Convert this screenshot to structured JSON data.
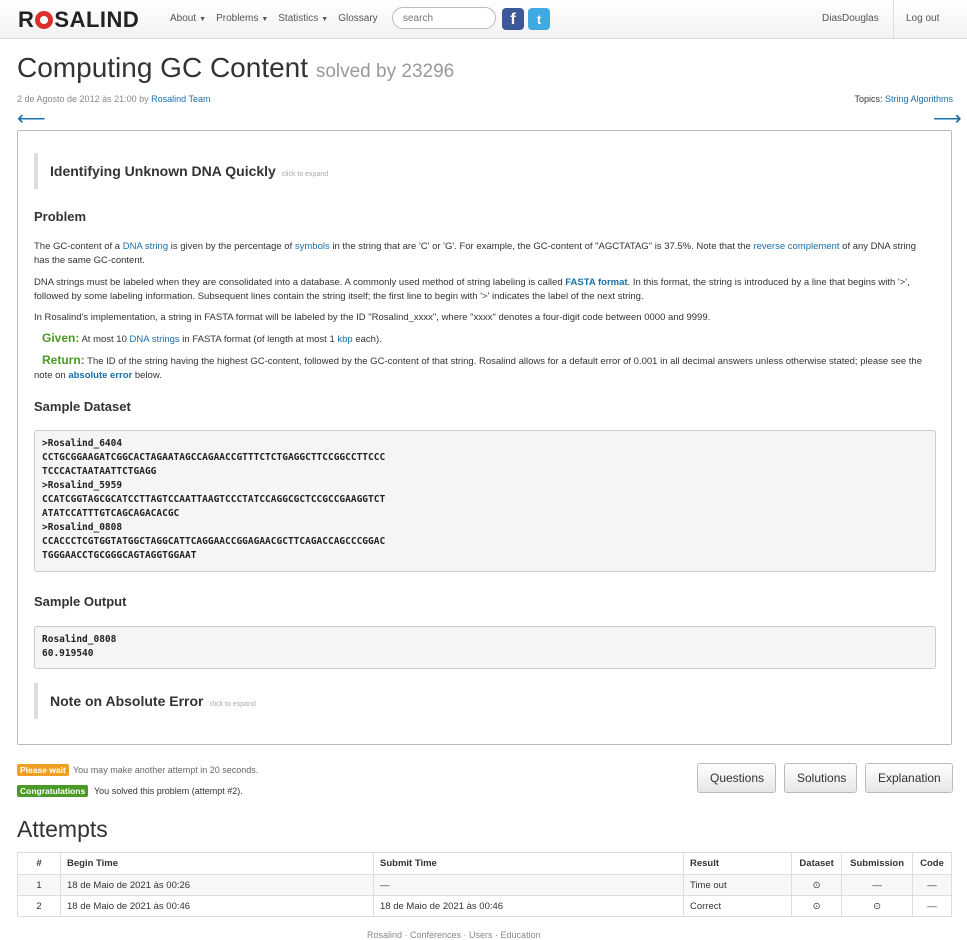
{
  "nav": {
    "logo": "ROSALIND",
    "menu": [
      {
        "label": "About",
        "caret": true
      },
      {
        "label": "Problems",
        "caret": true
      },
      {
        "label": "Statistics",
        "caret": true
      },
      {
        "label": "Glossary",
        "caret": false
      }
    ],
    "search_placeholder": "search",
    "user": "DiasDouglas",
    "logout": "Log out"
  },
  "problem": {
    "title": "Computing GC Content",
    "solved": "solved by 23296",
    "date": "2 de Agosto de 2012 às 21:00 by ",
    "author": "Rosalind Team",
    "topics_label": "Topics: ",
    "topics_link": "String Algorithms"
  },
  "content": {
    "intro_box": "Identifying Unknown DNA Quickly",
    "expand_label": "click to expand",
    "problem_heading": "Problem",
    "p1": {
      "a": "The GC-content of a ",
      "link1": "DNA string",
      "b": " is given by the percentage of ",
      "link2": "symbols",
      "c": " in the string that are 'C' or 'G'. For example, the GC-content of \"AGCTATAG\" is 37.5%. Note that the ",
      "link3": "reverse complement",
      "d": " of any DNA string has the same GC-content."
    },
    "p2": {
      "a": "DNA strings must be labeled when they are consolidated into a database. A commonly used method of string labeling is called ",
      "link": "FASTA format",
      "b": ". In this format, the string is introduced by a line that begins with '>', followed by some labeling information. Subsequent lines contain the string itself; the first line to begin with '>' indicates the label of the next string."
    },
    "p3": "In Rosalind's implementation, a string in FASTA format will be labeled by the ID \"Rosalind_xxxx\", where \"xxxx\" denotes a four-digit code between 0000 and 9999.",
    "given": {
      "label": "Given:",
      "a": " At most 10 ",
      "link1": "DNA strings",
      "b": " in FASTA format (of length at most 1 ",
      "link2": "kbp",
      "c": " each)."
    },
    "return": {
      "label": "Return:",
      "a": " The ID of the string having the highest GC-content, followed by the GC-content of that string. Rosalind allows for a default error of 0.001 in all decimal answers unless otherwise stated; please see the note on ",
      "link": "absolute error",
      "b": " below."
    },
    "sample_dataset_heading": "Sample Dataset",
    "sample_dataset": ">Rosalind_6404\nCCTGCGGAAGATCGGCACTAGAATAGCCAGAACCGTTTCTCTGAGGCTTCCGGCCTTCCC\nTCCCACTAATAATTCTGAGG\n>Rosalind_5959\nCCATCGGTAGCGCATCCTTAGTCCAATTAAGTCCCTATCCAGGCGCTCCGCCGAAGGTCT\nATATCCATTTGTCAGCAGACACGC\n>Rosalind_0808\nCCACCCTCGTGGTATGGCTAGGCATTCAGGAACCGGAGAACGCTTCAGACCAGCCCGGAC\nTGGGAACCTGCGGGCAGTAGGTGGAAT",
    "sample_output_heading": "Sample Output",
    "sample_output": "Rosalind_0808\n60.919540",
    "note_box": "Note on Absolute Error"
  },
  "status": {
    "wait_badge": "Please wait",
    "wait_text": "You may make another attempt in 20 seconds.",
    "ok_badge": "Congratulations",
    "ok_text": "You solved this problem (attempt #2)."
  },
  "buttons": {
    "questions": "Questions",
    "solutions": "Solutions",
    "explanation": "Explanation"
  },
  "attempts": {
    "title": "Attempts",
    "columns": [
      "#",
      "Begin Time",
      "Submit Time",
      "Result",
      "Dataset",
      "Submission",
      "Code"
    ],
    "rows": [
      {
        "n": "1",
        "begin": "18 de Maio de 2021 às 00:26",
        "submit": "—",
        "result": "Time out",
        "dataset": "⊙",
        "submission": "—",
        "code": "—"
      },
      {
        "n": "2",
        "begin": "18 de Maio de 2021 às 00:46",
        "submit": "18 de Maio de 2021 às 00:46",
        "result": "Correct",
        "dataset": "⊙",
        "submission": "⊙",
        "code": "—"
      }
    ]
  },
  "footer": "Rosalind · Conferences · Users · Education"
}
